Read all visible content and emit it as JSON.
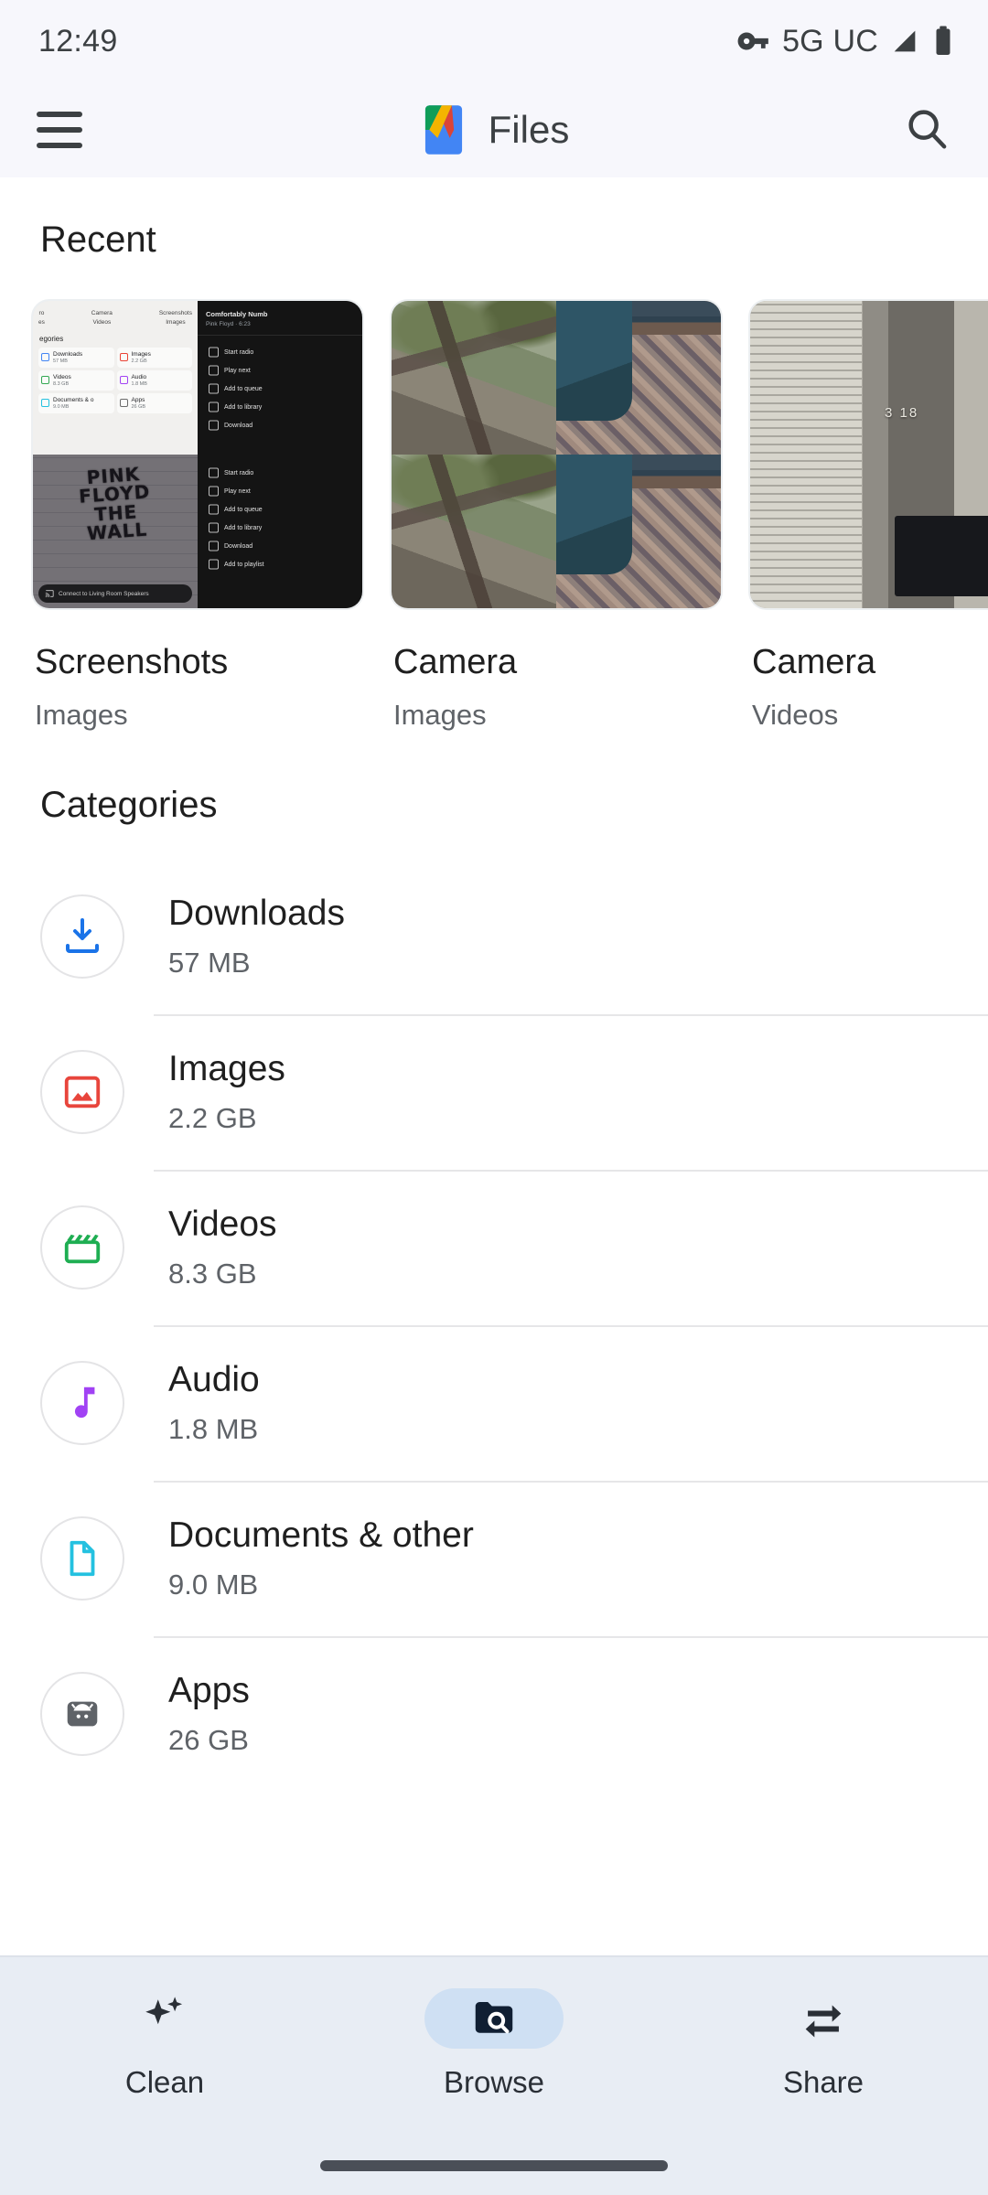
{
  "status_bar": {
    "time": "12:49",
    "network_label": "5G UC",
    "icons": [
      "vpn-key-icon",
      "signal-icon",
      "battery-icon"
    ]
  },
  "app_bar": {
    "menu_icon": "hamburger-menu-icon",
    "logo_icon": "files-app-logo",
    "title": "Files",
    "search_icon": "search-icon"
  },
  "recent": {
    "heading": "Recent",
    "items": [
      {
        "name": "Screenshots",
        "type": "Images"
      },
      {
        "name": "Camera",
        "type": "Images"
      },
      {
        "name": "Camera",
        "type": "Videos"
      }
    ],
    "screenshot_preview": {
      "tabs": [
        "Camera\nVideos",
        "Screenshots\nImages"
      ],
      "categories_label": "egories",
      "tiles": [
        {
          "name": "Downloads",
          "size": "57 MB"
        },
        {
          "name": "Images",
          "size": "2.2 GB"
        },
        {
          "name": "Videos",
          "size": "8.3 GB"
        },
        {
          "name": "Audio",
          "size": "1.8 MB"
        },
        {
          "name": "Documents & o",
          "size": "9.0 MB"
        },
        {
          "name": "Apps",
          "size": "26 GB"
        }
      ],
      "music_menu": {
        "track": "Comfortably Numb",
        "artist": "Pink Floyd · 6:23",
        "options": [
          "Start radio",
          "Play next",
          "Add to queue",
          "Add to library",
          "Download",
          "Add to playlist"
        ]
      },
      "wall_graffiti": "PINK\nFLOYD\nTHE\nWALL",
      "speaker_bar": "Connect to Living Room Speakers",
      "video_clock": "3  18"
    }
  },
  "categories": {
    "heading": "Categories",
    "items": [
      {
        "name": "Downloads",
        "size": "57 MB",
        "icon": "download-icon",
        "color": "#1a73e8"
      },
      {
        "name": "Images",
        "size": "2.2 GB",
        "icon": "image-icon",
        "color": "#e8453c"
      },
      {
        "name": "Videos",
        "size": "8.3 GB",
        "icon": "clapper-icon",
        "color": "#1eae52"
      },
      {
        "name": "Audio",
        "size": "1.8 MB",
        "icon": "music-note-icon",
        "color": "#a142f4"
      },
      {
        "name": "Documents & other",
        "size": "9.0 MB",
        "icon": "document-icon",
        "color": "#24c1e0"
      },
      {
        "name": "Apps",
        "size": "26 GB",
        "icon": "android-icon",
        "color": "#5f6368"
      }
    ]
  },
  "bottom_nav": {
    "items": [
      {
        "label": "Clean",
        "icon": "sparkles-icon",
        "active": false
      },
      {
        "label": "Browse",
        "icon": "folder-search-icon",
        "active": true
      },
      {
        "label": "Share",
        "icon": "swap-arrows-icon",
        "active": false
      }
    ]
  }
}
